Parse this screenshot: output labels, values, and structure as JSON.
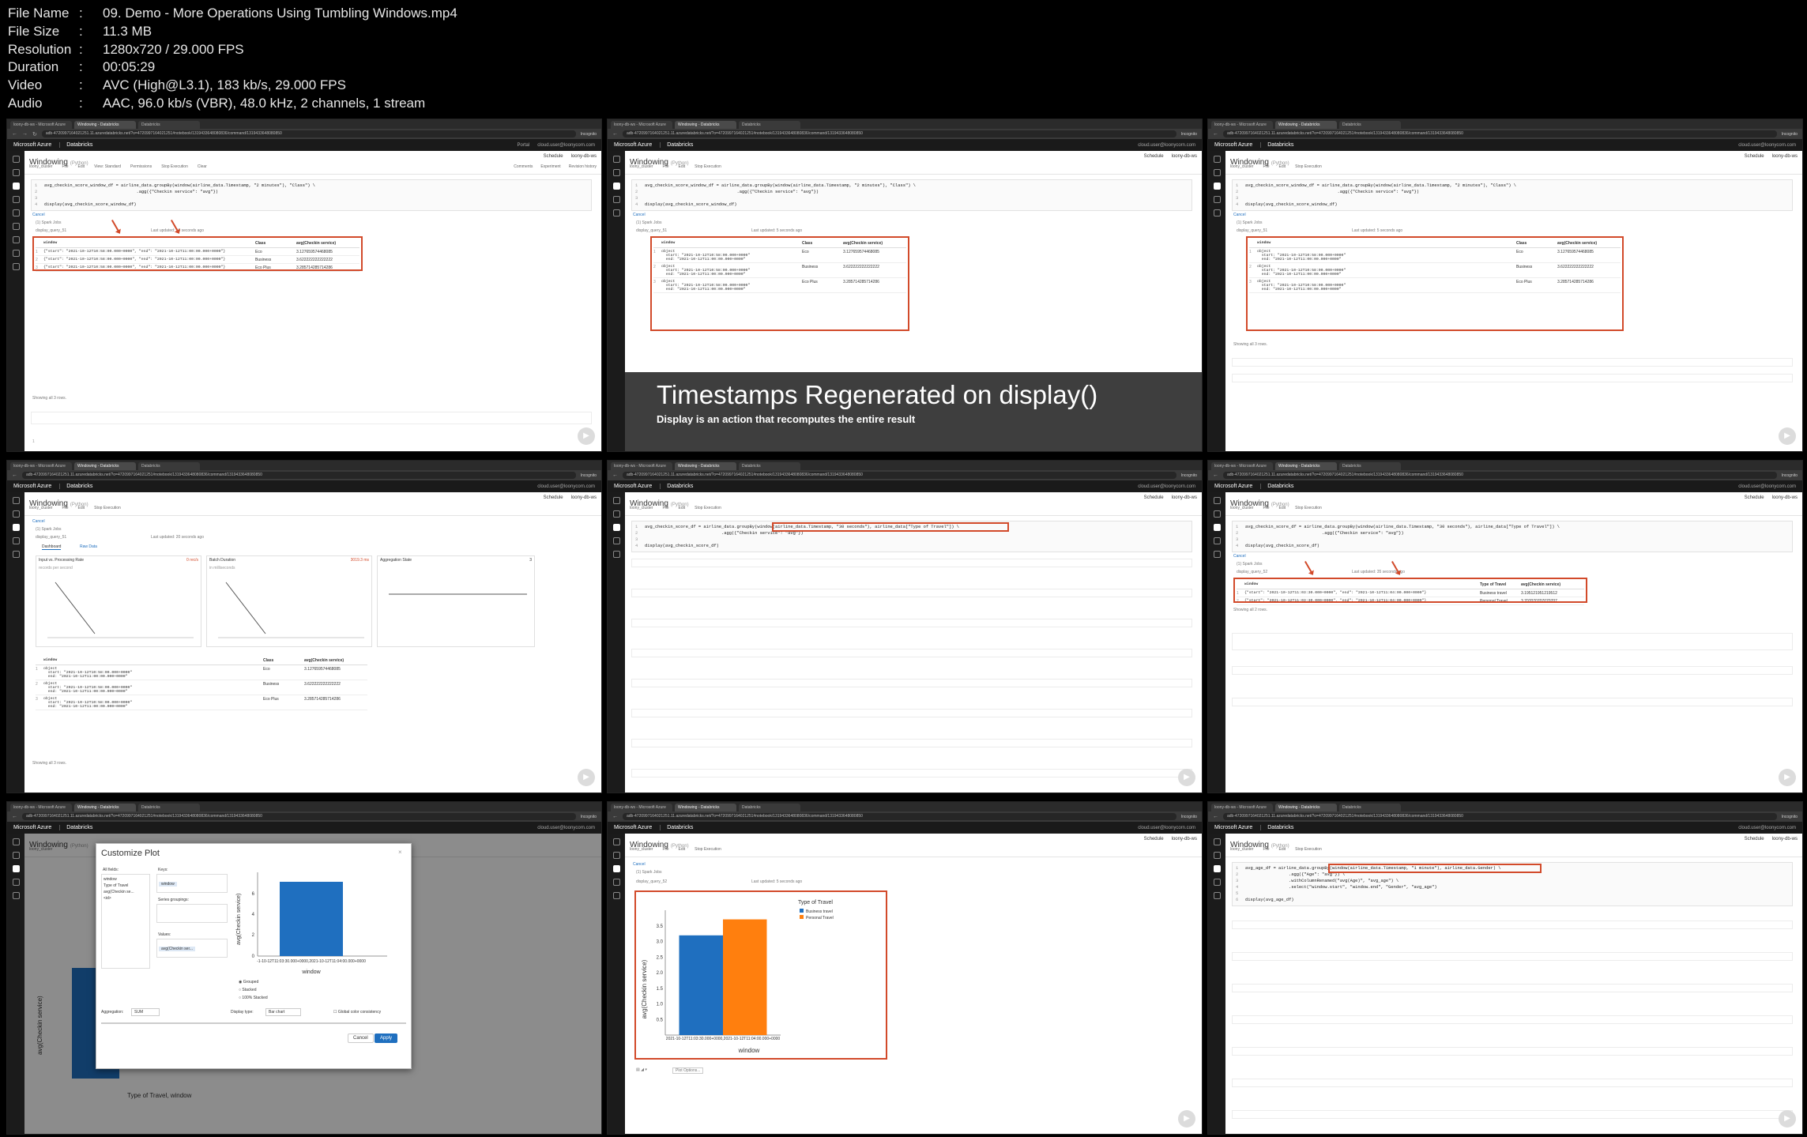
{
  "meta": [
    {
      "key": "File Name",
      "sep": ":",
      "value": "09. Demo - More Operations Using Tumbling Windows.mp4"
    },
    {
      "key": "File Size",
      "sep": ":",
      "value": "11.3 MB"
    },
    {
      "key": "Resolution",
      "sep": ":",
      "value": "1280x720 / 29.000 FPS"
    },
    {
      "key": "Duration",
      "sep": ":",
      "value": "00:05:29"
    },
    {
      "key": "Video",
      "sep": ":",
      "value": "AVC (High@L3.1), 183 kb/s, 29.000 FPS"
    },
    {
      "key": "Audio",
      "sep": ":",
      "value": "AAC, 96.0 kb/s (VBR), 48.0 kHz, 2 channels, 1 stream"
    }
  ],
  "browser": {
    "tabs": [
      "loony-db-ws - Microsoft Azure",
      "Windowing - Databricks",
      "Databricks"
    ],
    "url": "adb-4720997164021251.11.azuredatabricks.net/?o=4720997164021251#notebook/1319433648080836/command/1319433648080850",
    "incognito": "Incognito",
    "azure": "Microsoft Azure",
    "databricks": "Databricks",
    "portal": "Portal",
    "user": "cloud.user@loonycorn.com"
  },
  "notebook": {
    "title": "Windowing",
    "lang": "(Python)",
    "schedule": "Schedule",
    "workspace": "loony-db-ws",
    "cluster": "loony_cluster",
    "menu": [
      "File",
      "Edit",
      "View: Standard",
      "Permissions",
      "Stop Execution",
      "Clear"
    ],
    "right_menu": [
      "Comments",
      "Experiment",
      "Revision history"
    ]
  },
  "tile1": {
    "code": [
      "avg_checkin_score_window_df = airline_data.groupBy(window(airline_data.Timestamp, \"2 minutes\"), \"Class\") \\",
      "                                    .agg({\"Checkin service\": \"avg\"})",
      "",
      "display(avg_checkin_score_window_df)"
    ],
    "cancel": "Cancel",
    "spark_jobs": "(1) Spark Jobs",
    "display_query": "display_query_51",
    "last_updated": "Last updated: 10 seconds ago",
    "headers": [
      "window",
      "Class",
      "avg(Checkin service)"
    ],
    "rows": [
      {
        "n": "1",
        "window": "{\"start\": \"2021-10-12T10:58:00.000+0000\", \"end\": \"2021-10-12T11:00:00.000+0000\"}",
        "cls": "Eco",
        "avg": "3.127659574468085"
      },
      {
        "n": "2",
        "window": "{\"start\": \"2021-10-12T10:58:00.000+0000\", \"end\": \"2021-10-12T11:00:00.000+0000\"}",
        "cls": "Business",
        "avg": "3.622222222222222"
      },
      {
        "n": "3",
        "window": "{\"start\": \"2021-10-12T10:58:00.000+0000\", \"end\": \"2021-10-12T11:00:00.000+0000\"}",
        "cls": "Eco Plus",
        "avg": "3.285714285714286"
      }
    ],
    "showing": "Showing all 3 rows."
  },
  "tile2": {
    "rows": [
      {
        "n": "1",
        "start": "start: \"2021-10-12T10:58:00.000+0000\"",
        "end": "end: \"2021-10-12T11:00:00.000+0000\"",
        "cls": "Eco",
        "avg": "3.127659574468085"
      },
      {
        "n": "2",
        "start": "start: \"2021-10-12T10:58:00.000+0000\"",
        "end": "end: \"2021-10-12T11:00:00.000+0000\"",
        "cls": "Business",
        "avg": "3.622222222222222"
      },
      {
        "n": "3",
        "start": "start: \"2021-10-12T10:58:00.000+0000\"",
        "end": "end: \"2021-10-12T11:00:00.000+0000\"",
        "cls": "Eco Plus",
        "avg": "3.285714285714286"
      }
    ],
    "object_label": "object",
    "last_updated": "Last updated: 5 seconds ago",
    "banner_title": "Timestamps Regenerated on display()",
    "banner_sub": "Display is an action that recomputes the entire result"
  },
  "tile3": {
    "last_updated": "Last updated: 5 seconds ago"
  },
  "tile4": {
    "last_updated": "Last updated: 20 seconds ago",
    "tabs": [
      "Dashboard",
      "Raw Data"
    ],
    "panels": [
      {
        "title": "Input vs. Processing Rate",
        "sub": "records per second",
        "value": "0 rec/s"
      },
      {
        "title": "Batch Duration",
        "sub": "in milliseconds",
        "value": "3019.3 ms"
      },
      {
        "title": "Aggregation State",
        "sub": "",
        "value": "3"
      }
    ]
  },
  "tile5": {
    "code": [
      "avg_checkin_score_df = airline_data.groupBy(window(airline_data.Timestamp, \"30 seconds\"), airline_data[\"Type of Travel\"]) \\",
      "                              .agg({\"Checkin service\": \"avg\"})",
      "",
      "display(avg_checkin_score_df)"
    ]
  },
  "tile6": {
    "code": [
      "avg_checkin_score_df = airline_data.groupBy(window(airline_data.Timestamp, \"30 seconds\"), airline_data[\"Type of Travel\"]) \\",
      "                              .agg({\"Checkin service\": \"avg\"})",
      "",
      "display(avg_checkin_score_df)"
    ],
    "display_query": "display_query_52",
    "last_updated": "Last updated: 35 seconds ago",
    "headers": [
      "window",
      "Type of Travel",
      "avg(Checkin service)"
    ],
    "rows": [
      {
        "n": "1",
        "window": "{\"start\": \"2021-10-12T11:03:30.000+0000\", \"end\": \"2021-10-12T11:04:00.000+0000\"}",
        "cls": "Business travel",
        "avg": "3.195121951219512"
      },
      {
        "n": "2",
        "window": "{\"start\": \"2021-10-12T11:03:30.000+0000\", \"end\": \"2021-10-12T11:04:00.000+0000\"}",
        "cls": "Personal Travel",
        "avg": "3.707070707070707"
      }
    ],
    "showing": "Showing all 2 rows."
  },
  "tile7": {
    "modal_title": "Customize Plot",
    "all_fields_label": "All fields:",
    "all_fields": [
      "window",
      "Type of Travel",
      "avg(Checkin se...",
      "<id>"
    ],
    "keys_label": "Keys:",
    "keys_value": "window",
    "series_label": "Series groupings:",
    "values_label": "Values:",
    "values_value": "avg(Checkin ser...",
    "options": [
      "Grouped",
      "Stacked",
      "100% Stacked"
    ],
    "aggregation_label": "Aggregation:",
    "aggregation_value": "SUM",
    "display_type_label": "Display type:",
    "display_type_value": "Bar chart",
    "global_color": "Global color consistency",
    "cancel": "Cancel",
    "apply": "Apply",
    "xlabel": "window",
    "ylabel": "avg(Checkin service)",
    "xtick": "-1-10-12T11:03:30.000+0000,2021-10-12T11:04:00.000+0000",
    "bg_xlabel": "Type of Travel, window",
    "bg_ylabel": "avg(Checkin service)"
  },
  "tile8": {
    "display_query": "display_query_52",
    "last_updated": "Last updated: 5 seconds ago",
    "plot_options": "Plot Options..."
  },
  "chart_data": {
    "type": "bar",
    "title": "",
    "xlabel": "window",
    "ylabel": "avg(Checkin service)",
    "categories": [
      "2021-10-12T11:03:30.000+0000,2021-10-12T11:04:00.000+0000"
    ],
    "series": [
      {
        "name": "Business travel",
        "values": [
          3.195
        ]
      },
      {
        "name": "Personal Travel",
        "values": [
          3.707
        ]
      }
    ],
    "legend_title": "Type of Travel",
    "legend_position": "top-right",
    "ylim": [
      0,
      4
    ],
    "yticks": [
      "0.5",
      "1.0",
      "1.5",
      "2.0",
      "2.5",
      "3.0",
      "3.5"
    ],
    "colors": [
      "#1f6fbf",
      "#ff7f0e"
    ]
  },
  "tile9": {
    "code": [
      "avg_age_df = airline_data.groupBy(window(airline_data.Timestamp, \"1 minute\"), airline_data.Gender) \\",
      "                 .agg({\"Age\": \"avg\"}) \\",
      "                 .withColumnRenamed(\"avg(Age)\", \"avg_age\") \\",
      "                 .select(\"window.start\", \"window.end\", \"Gender\", \"avg_age\")",
      "",
      "display(avg_age_df)"
    ]
  }
}
